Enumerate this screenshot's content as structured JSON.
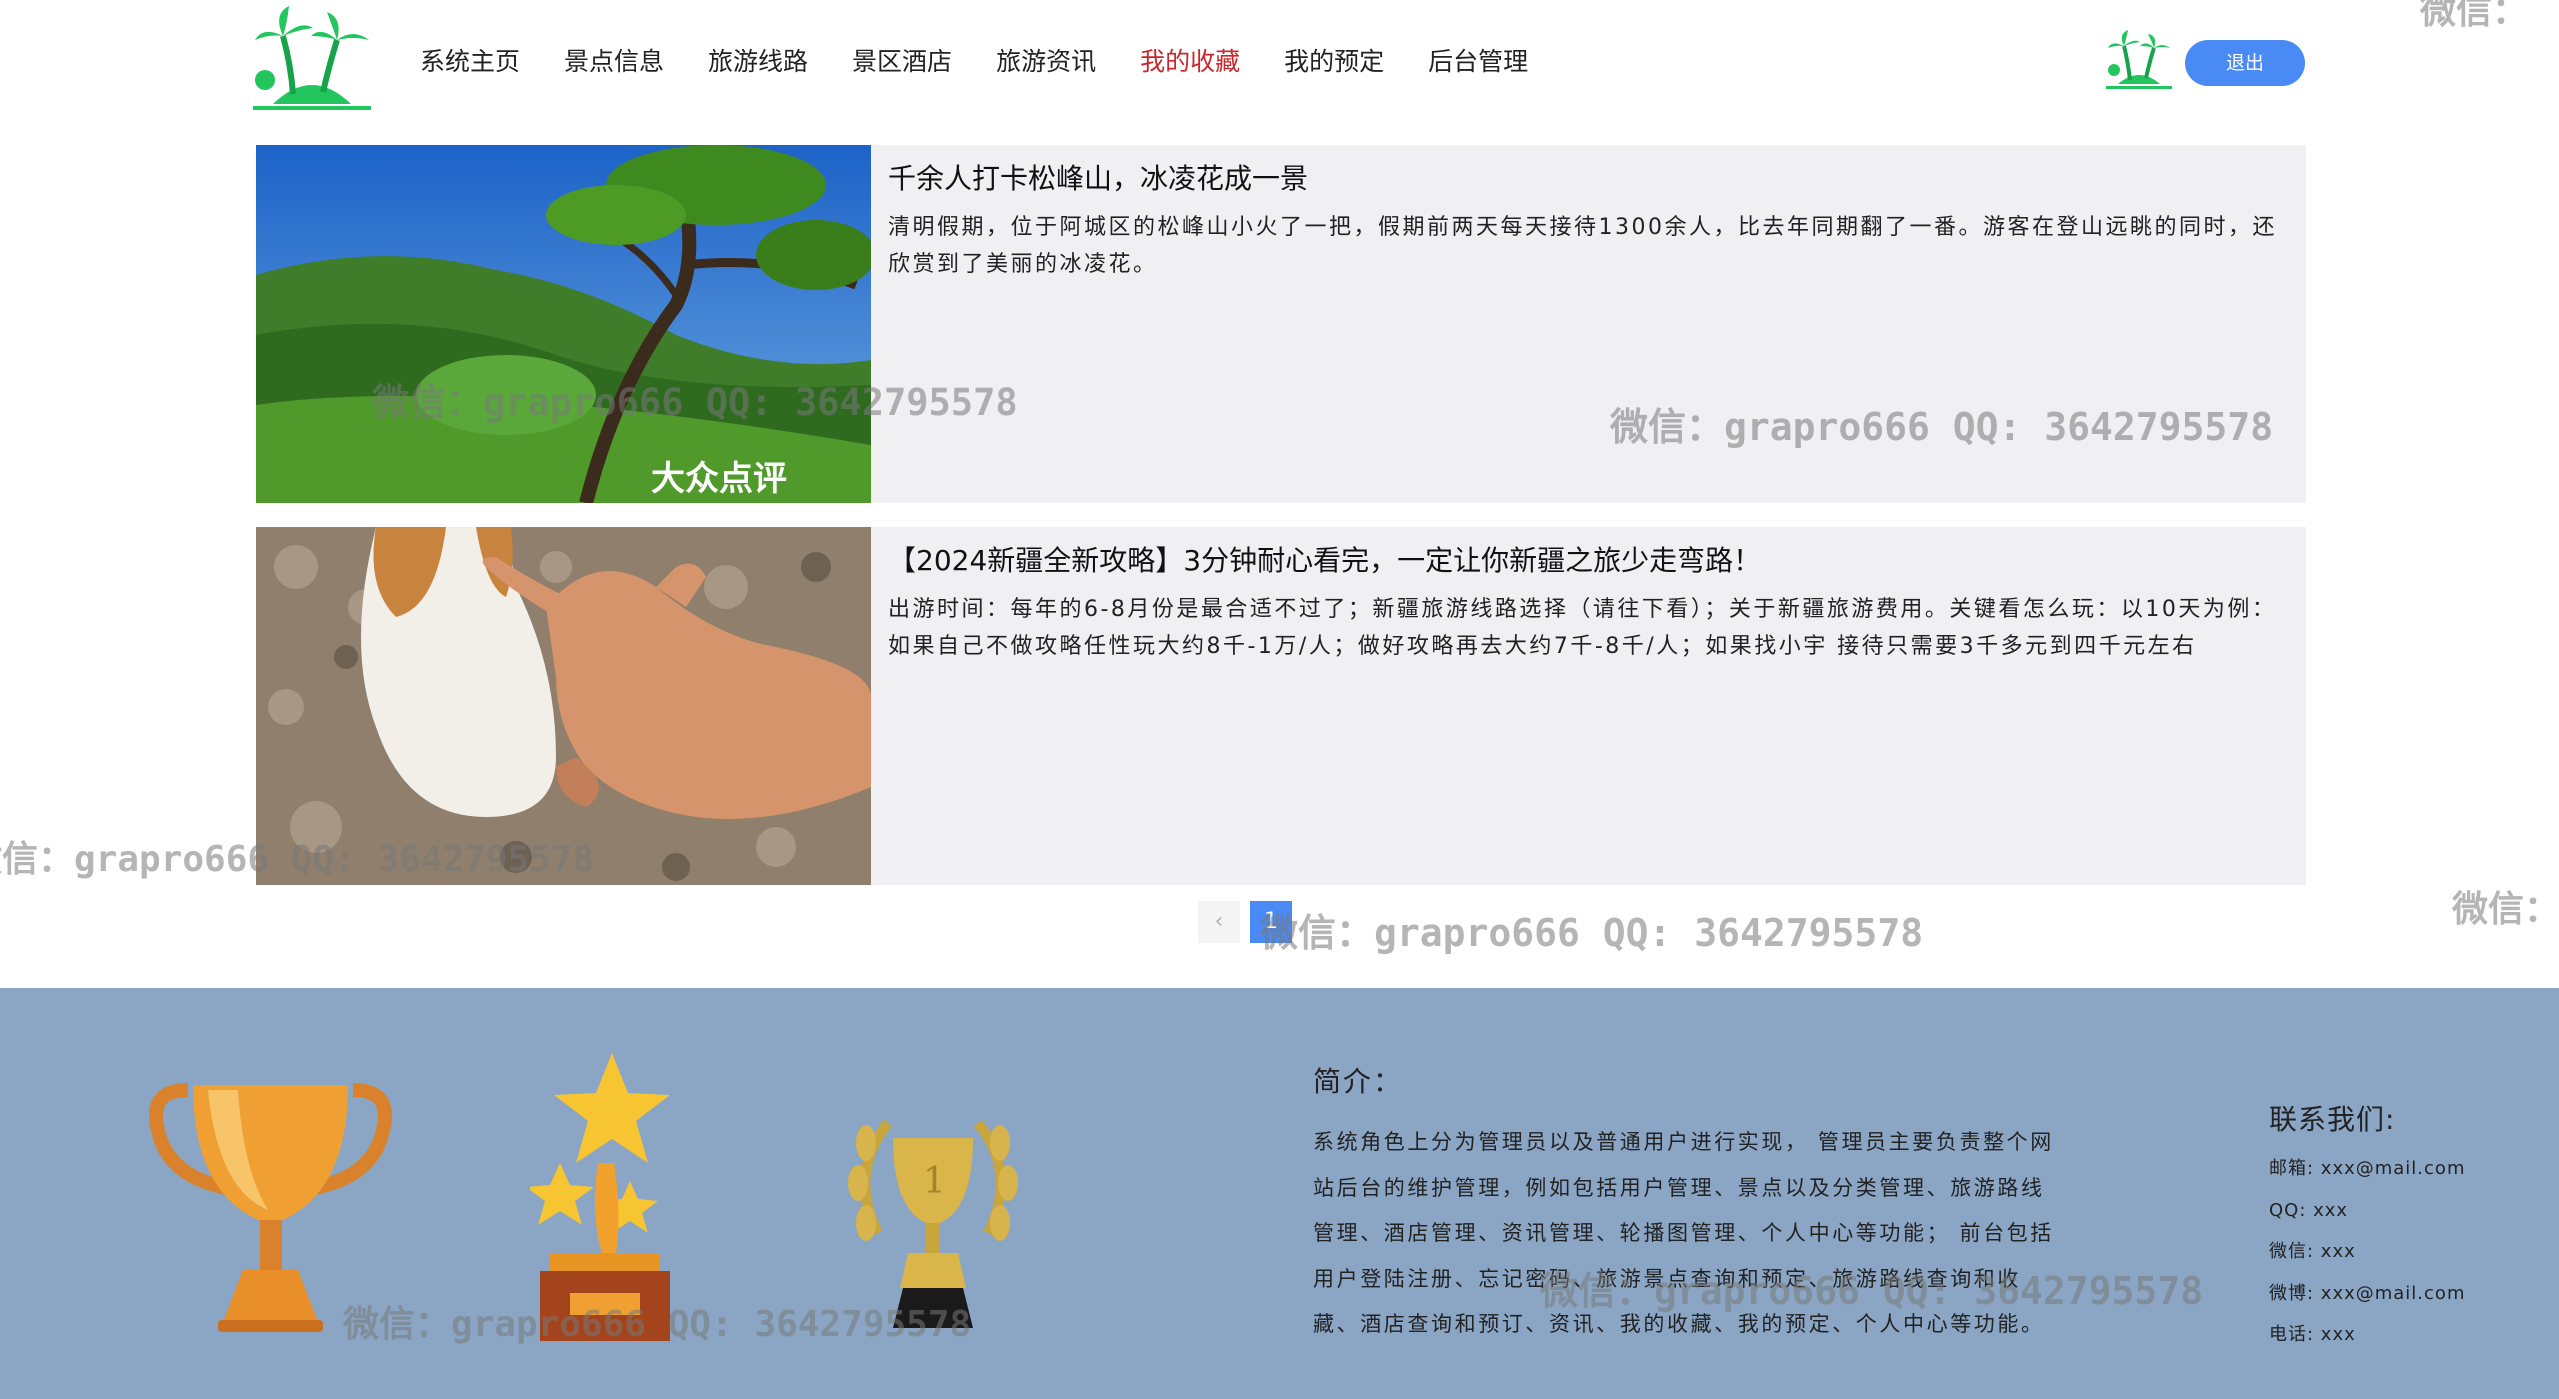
{
  "nav": {
    "items": [
      {
        "label": "系统主页"
      },
      {
        "label": "景点信息"
      },
      {
        "label": "旅游线路"
      },
      {
        "label": "景区酒店"
      },
      {
        "label": "旅游资讯"
      },
      {
        "label": "我的收藏"
      },
      {
        "label": "我的预定"
      },
      {
        "label": "后台管理"
      }
    ],
    "active_index": 5,
    "logout_label": "退出"
  },
  "news": [
    {
      "title": "千余人打卡松峰山，冰凌花成一景",
      "summary": "清明假期，位于阿城区的松峰山小火了一把，假期前两天每天接待1300余人，比去年同期翻了一番。游客在登山远眺的同时，还欣赏到了美丽的冰凌花。",
      "image_watermark": "大众点评"
    },
    {
      "title": "【2024新疆全新攻略】3分钟耐心看完，一定让你新疆之旅少走弯路！",
      "summary": "出游时间：每年的6-8月份是最合适不过了；新疆旅游线路选择（请往下看）；关于新疆旅游费用。关键看怎么玩：以10天为例：如果自己不做攻略任性玩大约8千-1万/人；做好攻略再去大约7千-8千/人；如果找小宇 接待只需要3千多元到四千元左右"
    }
  ],
  "pagination": {
    "prev_icon": "chevron-left-icon",
    "current_page": "1"
  },
  "footer": {
    "intro_heading": "简介：",
    "intro_text": "系统角色上分为管理员以及普通用户进行实现， 管理员主要负责整个网站后台的维护管理，例如包括用户管理、景点以及分类管理、旅游路线管理、酒店管理、资讯管理、轮播图管理、个人中心等功能； 前台包括用户登陆注册、忘记密码、旅游景点查询和预定、旅游路线查询和收藏、酒店查询和预订、资讯、我的收藏、我的预定、个人中心等功能。",
    "contact_heading": "联系我们:",
    "contacts": [
      {
        "label": "邮箱: xxx@mail.com"
      },
      {
        "label": "QQ: xxx"
      },
      {
        "label": "微信: xxx"
      },
      {
        "label": "微博: xxx@mail.com"
      },
      {
        "label": "电话: xxx"
      }
    ]
  },
  "watermarks": {
    "text": "微信：grapro666 QQ: 3642795578",
    "edge_text": "微信："
  },
  "colors": {
    "accent": "#4a8af4",
    "active_nav": "#c8282c",
    "footer_bg": "#8ba6c4",
    "card_bg": "#f0f0f2"
  }
}
